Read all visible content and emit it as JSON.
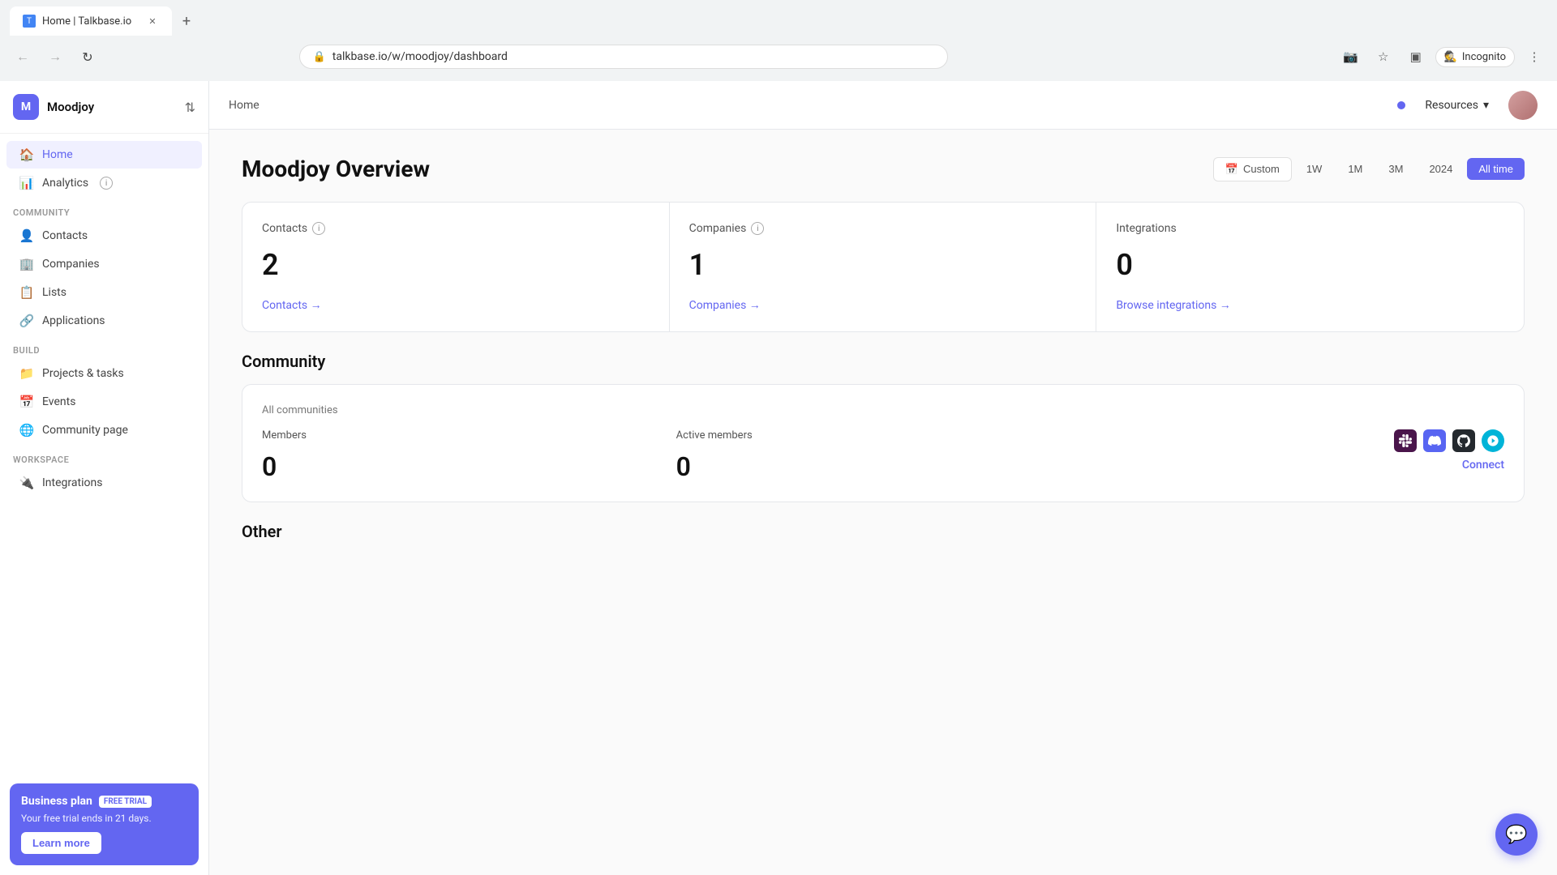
{
  "browser": {
    "tab_title": "Home | Talkbase.io",
    "favicon_letter": "T",
    "address": "talkbase.io/w/moodjoy/dashboard",
    "incognito_label": "Incognito"
  },
  "sidebar": {
    "workspace_initial": "M",
    "workspace_name": "Moodjoy",
    "nav_items": [
      {
        "id": "home",
        "label": "Home",
        "icon": "🏠",
        "active": true
      },
      {
        "id": "analytics",
        "label": "Analytics",
        "icon": "📊",
        "active": false
      }
    ],
    "community_section_label": "COMMUNITY",
    "community_items": [
      {
        "id": "contacts",
        "label": "Contacts",
        "icon": "👤"
      },
      {
        "id": "companies",
        "label": "Companies",
        "icon": "🏢"
      },
      {
        "id": "lists",
        "label": "Lists",
        "icon": "📋"
      },
      {
        "id": "applications",
        "label": "Applications",
        "icon": "🔗"
      }
    ],
    "build_section_label": "BUILD",
    "build_items": [
      {
        "id": "projects",
        "label": "Projects & tasks",
        "icon": "📁"
      },
      {
        "id": "events",
        "label": "Events",
        "icon": "📅"
      },
      {
        "id": "community_page",
        "label": "Community page",
        "icon": "🌐"
      }
    ],
    "workspace_section_label": "WORKSPACE",
    "workspace_items": [
      {
        "id": "integrations",
        "label": "Integrations",
        "icon": "🔌"
      }
    ],
    "business_plan": {
      "title": "Business plan",
      "badge": "FREE TRIAL",
      "description": "Your free trial ends in 21 days.",
      "learn_more": "Learn more"
    }
  },
  "topbar": {
    "breadcrumb": "Home",
    "resources_label": "Resources"
  },
  "main": {
    "page_title": "Moodjoy Overview",
    "time_filters": [
      {
        "id": "custom",
        "label": "Custom",
        "active": false
      },
      {
        "id": "1w",
        "label": "1W",
        "active": false
      },
      {
        "id": "1m",
        "label": "1M",
        "active": false
      },
      {
        "id": "3m",
        "label": "3M",
        "active": false
      },
      {
        "id": "2024",
        "label": "2024",
        "active": false
      },
      {
        "id": "all",
        "label": "All time",
        "active": true
      }
    ],
    "stats": [
      {
        "id": "contacts",
        "label": "Contacts",
        "value": "2",
        "link_text": "Contacts →"
      },
      {
        "id": "companies",
        "label": "Companies",
        "value": "1",
        "link_text": "Companies →"
      },
      {
        "id": "integrations",
        "label": "Integrations",
        "value": "0",
        "link_text": "Browse integrations →"
      }
    ],
    "community_section_title": "Community",
    "community_card": {
      "subtitle": "All communities",
      "members_label": "Members",
      "members_value": "0",
      "active_members_label": "Active members",
      "active_members_value": "0",
      "connect_label": "Connect"
    },
    "other_title": "Other"
  }
}
